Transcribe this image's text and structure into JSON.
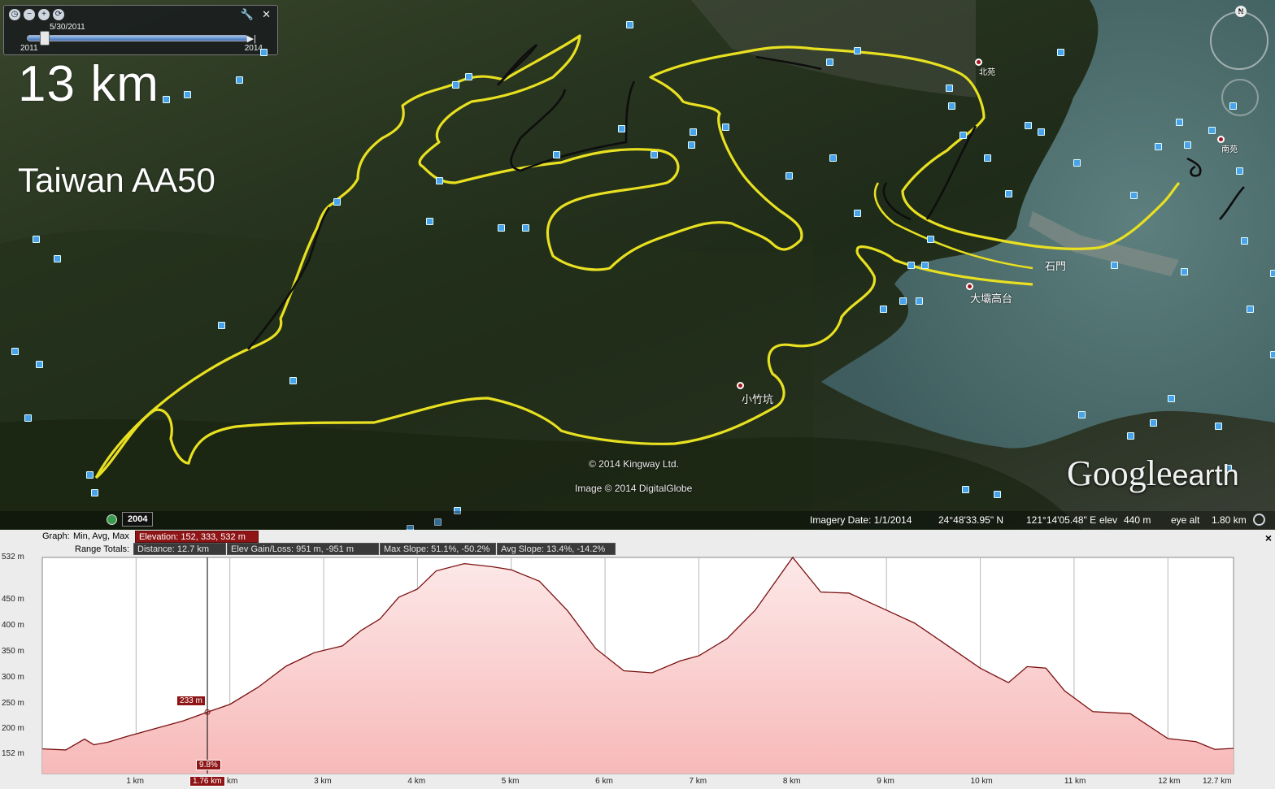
{
  "timeslider": {
    "current_date": "5/30/2011",
    "start_year": "2011",
    "end_year": "2014",
    "icons": [
      "clock-icon",
      "zoom-out-icon",
      "zoom-in-icon",
      "refresh-icon"
    ],
    "tool_icons": [
      "wrench-icon",
      "close-icon"
    ],
    "close_label": "✕"
  },
  "overlay": {
    "distance_title": "13 km",
    "race_title": "Taiwan AA50"
  },
  "places": {
    "beiyuan": "北苑",
    "nanyuan": "南苑",
    "shimen": "石門",
    "dabagaotai": "大壩高台",
    "xiaozhukeng": "小竹坑"
  },
  "attribution": {
    "kingway": "© 2014 Kingway Ltd.",
    "digitalglobe": "Image © 2014 DigitalGlobe",
    "brand_main": "Google",
    "brand_sub": "earth"
  },
  "historical_year": "2004",
  "status": {
    "imagery_date": "Imagery Date: 1/1/2014",
    "lat": "24°48'33.95\" N",
    "lon": "121°14'05.48\" E",
    "elev_label": "elev",
    "elev_value": "440 m",
    "eye_alt_label": "eye alt",
    "eye_alt_value": "1.80 km"
  },
  "profile": {
    "graph_label": "Graph:",
    "graph_mode": "Min, Avg, Max",
    "elevation_stat": "Elevation: 152, 333, 532 m",
    "range_label": "Range Totals:",
    "distance_stat": "Distance: 12.7 km",
    "gain_stat": "Elev Gain/Loss: 951 m, -951 m",
    "max_slope_stat": "Max Slope: 51.1%, -50.2%",
    "avg_slope_stat": "Avg Slope: 13.4%, -14.2%",
    "close_label": "×",
    "cursor": {
      "elevation": "233 m",
      "slope": "9.8%",
      "distance": "1.76 km",
      "distance_value": 1.76,
      "elevation_value": 233
    }
  },
  "colors": {
    "track": "#e8e020",
    "accent_red": "#8e1416",
    "fill_pink": "#f8c8c8",
    "line": "#7a1010"
  },
  "chart_data": {
    "type": "area",
    "x_unit": "km",
    "y_unit": "m",
    "xlim": [
      0,
      12.7
    ],
    "ylim": [
      152,
      532
    ],
    "y_ticks": [
      "532 m",
      "450 m",
      "400 m",
      "350 m",
      "300 m",
      "250 m",
      "200 m",
      "152 m"
    ],
    "y_tick_values": [
      532,
      450,
      400,
      350,
      300,
      250,
      200,
      152
    ],
    "x_ticks": [
      "1 km",
      "2 km",
      "3 km",
      "4 km",
      "5 km",
      "6 km",
      "7 km",
      "8 km",
      "9 km",
      "10 km",
      "11 km",
      "12 km",
      "12.7 km"
    ],
    "x_tick_values": [
      1,
      2,
      3,
      4,
      5,
      6,
      7,
      8,
      9,
      10,
      11,
      12,
      12.7
    ],
    "x": [
      0,
      0.25,
      0.45,
      0.55,
      0.7,
      0.9,
      1.2,
      1.5,
      1.76,
      2.0,
      2.3,
      2.6,
      2.9,
      3.2,
      3.4,
      3.6,
      3.8,
      4.0,
      4.2,
      4.5,
      4.8,
      5.0,
      5.3,
      5.6,
      5.9,
      6.2,
      6.5,
      6.8,
      7.0,
      7.3,
      7.6,
      8.0,
      8.3,
      8.6,
      9.0,
      9.3,
      9.6,
      10.0,
      10.3,
      10.5,
      10.7,
      10.9,
      11.2,
      11.6,
      12.0,
      12.3,
      12.5,
      12.7
    ],
    "y": [
      162,
      160,
      181,
      170,
      175,
      186,
      201,
      216,
      233,
      248,
      281,
      322,
      348,
      361,
      391,
      413,
      455,
      471,
      506,
      520,
      514,
      508,
      486,
      429,
      356,
      313,
      309,
      332,
      342,
      375,
      430,
      532,
      465,
      463,
      430,
      405,
      368,
      318,
      290,
      321,
      318,
      274,
      234,
      230,
      182,
      176,
      161,
      163
    ]
  }
}
